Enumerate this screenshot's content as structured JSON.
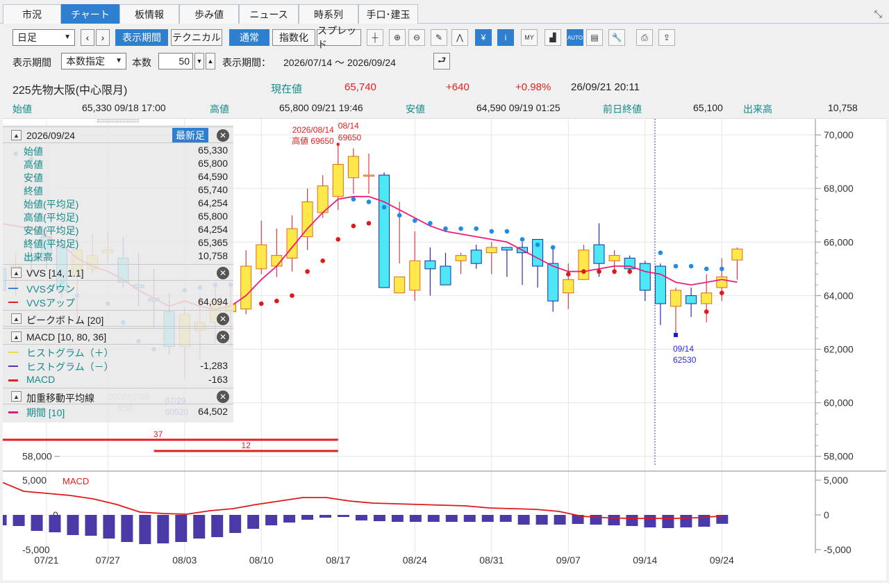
{
  "tabs": [
    "市況",
    "チャート",
    "板情報",
    "歩み値",
    "ニュース",
    "時系列",
    "手口･建玉"
  ],
  "active_tab": "チャート",
  "toolbar": {
    "interval_select": "日足",
    "prev_icon": "‹",
    "next_icon": "›",
    "period_button": "表示期間",
    "technical_button": "テクニカル",
    "normal_button": "通常",
    "index_button": "指数化",
    "spread_button": "スプレッド",
    "icons": [
      "crosshair-icon",
      "zoom-in-icon",
      "zoom-out-icon",
      "pencil-icon",
      "trend-icon",
      "yen-icon",
      "info-icon",
      "my-chart-icon",
      "volume-icon",
      "auto-scale-icon",
      "chart-settings-icon",
      "wrench-icon",
      "print-icon",
      "export-icon"
    ]
  },
  "period_row": {
    "label": "表示期間",
    "mode_select": "本数指定",
    "count_label": "本数",
    "count_value": "50",
    "range_label": "表示期間：",
    "range_value": "2026/07/14 ～ 2026/09/24"
  },
  "quote": {
    "name": "225先物大阪(中心限月)",
    "current_label": "現在値",
    "current_value": "65,740",
    "change": "+640",
    "change_pct": "+0.98%",
    "timestamp": "26/09/21  20:11",
    "open_label": "始値",
    "open_value": "65,330  09/18  17:00",
    "high_label": "高値",
    "high_value": "65,800  09/21  19:46",
    "low_label": "安値",
    "low_value": "64,590  09/19  01:25",
    "prev_close_label": "前日終値",
    "prev_close_value": "65,100",
    "volume_label": "出来高",
    "volume_value": "10,758"
  },
  "panel": {
    "date": "2026/09/24",
    "latest_button": "最新足",
    "ohlc": [
      {
        "k": "始値",
        "v": "65,330"
      },
      {
        "k": "高値",
        "v": "65,800"
      },
      {
        "k": "安値",
        "v": "64,590"
      },
      {
        "k": "終値",
        "v": "65,740"
      },
      {
        "k": "始値(平均足)",
        "v": "64,254"
      },
      {
        "k": "高値(平均足)",
        "v": "65,800"
      },
      {
        "k": "安値(平均足)",
        "v": "64,254"
      },
      {
        "k": "終値(平均足)",
        "v": "65,365"
      },
      {
        "k": "出来高",
        "v": "10,758"
      }
    ],
    "vvs_title": "VVS [14, 1.1]",
    "vvs_down": "VVSダウン",
    "vvs_up": "VVSアップ",
    "vvs_up_value": "64,094",
    "peak_title": "ピークボトム [20]",
    "macd_title": "MACD [10, 80, 36]",
    "hist_plus": "ヒストグラム（＋）",
    "hist_minus": "ヒストグラム（－）",
    "hist_minus_value": "-1,283",
    "macd_label": "MACD",
    "macd_value": "-163",
    "wma_title": "加重移動平均線",
    "wma_period": "期間 [10]",
    "wma_value": "64,502"
  },
  "chart_data": [
    {
      "type": "candlestick",
      "y_ticks": [
        "70,000",
        "68,000",
        "66,000",
        "64,000",
        "62,000",
        "60,000",
        "58,000"
      ],
      "ylim": [
        57500,
        70600
      ],
      "x_ticks": [
        "07/21",
        "07/27",
        "08/03",
        "08/10",
        "08/17",
        "08/24",
        "08/31",
        "09/07",
        "09/14",
        "09/24"
      ],
      "annotations": {
        "high_a": "2026/08/14",
        "high_a2": "高値 69650",
        "high_b": "08/14",
        "high_b2": "69650",
        "low_a": "2026/07/29",
        "low_a2": "安値",
        "low_b": "07/29",
        "low_b2": "60520",
        "low_c": "09/14",
        "low_c2": "62530",
        "bar_37": "37",
        "bar_12": "12",
        "left_axis_label": "58,000"
      },
      "candles": [
        [
          65000,
          65300,
          64000,
          64200
        ],
        [
          64800,
          65600,
          64000,
          65100
        ],
        [
          65500,
          66100,
          64800,
          65300
        ],
        [
          66200,
          66600,
          65000,
          65500
        ],
        [
          65800,
          66100,
          63900,
          64200
        ],
        [
          64800,
          66200,
          63000,
          65700
        ],
        [
          65000,
          66300,
          64800,
          65500
        ],
        [
          65600,
          66400,
          65200,
          65700
        ],
        [
          65400,
          66200,
          64300,
          64500
        ],
        [
          64400,
          65600,
          63600,
          64300
        ],
        [
          63900,
          65000,
          62800,
          63800
        ],
        [
          63400,
          64100,
          61800,
          62100
        ],
        [
          62100,
          63600,
          60900,
          63300
        ],
        [
          62700,
          64000,
          61600,
          63000
        ],
        [
          63000,
          64500,
          62200,
          63800
        ],
        [
          63400,
          64400,
          62100,
          63700
        ],
        [
          63500,
          65700,
          63300,
          65100
        ],
        [
          65000,
          66800,
          64800,
          65900
        ],
        [
          65100,
          66500,
          64700,
          65500
        ],
        [
          65400,
          67000,
          64900,
          66500
        ],
        [
          66200,
          68000,
          65700,
          67500
        ],
        [
          67100,
          68500,
          66900,
          68100
        ],
        [
          67700,
          69650,
          67200,
          68900
        ],
        [
          68400,
          69500,
          67800,
          69200
        ],
        [
          68500,
          69300,
          67800,
          68500
        ],
        [
          68500,
          68600,
          64800,
          64300
        ],
        [
          64100,
          67500,
          65200,
          64700
        ],
        [
          64200,
          66400,
          63800,
          65300
        ],
        [
          65300,
          65800,
          64000,
          65000
        ],
        [
          65100,
          65600,
          64500,
          64400
        ],
        [
          65300,
          65600,
          64800,
          65500
        ],
        [
          65700,
          65900,
          65000,
          65200
        ],
        [
          65600,
          66000,
          64800,
          65800
        ],
        [
          65800,
          65800,
          64700,
          65700
        ],
        [
          65800,
          66000,
          64400,
          65600
        ],
        [
          66100,
          66100,
          64300,
          65100
        ],
        [
          65200,
          65800,
          63400,
          63800
        ],
        [
          64100,
          65200,
          63500,
          64600
        ],
        [
          64600,
          65900,
          64900,
          65700
        ],
        [
          65900,
          66700,
          64700,
          65200
        ],
        [
          65300,
          65700,
          64800,
          65500
        ],
        [
          65400,
          65500,
          64800,
          65000
        ],
        [
          65200,
          65300,
          63800,
          64200
        ],
        [
          65100,
          65200,
          62900,
          63700
        ],
        [
          63600,
          64300,
          62530,
          64200
        ],
        [
          64000,
          64300,
          63200,
          63700
        ],
        [
          63700,
          64800,
          63000,
          64100
        ],
        [
          64300,
          65400,
          63800,
          64700
        ],
        [
          65330,
          65800,
          64590,
          65740
        ]
      ],
      "wma": [
        66700,
        66600,
        66500,
        66200,
        65900,
        65400,
        65100,
        64900,
        64600,
        64200,
        63900,
        63600,
        63800,
        63600,
        63500,
        63600,
        64000,
        64600,
        65100,
        65800,
        66500,
        67100,
        67600,
        67700,
        67700,
        67500,
        67200,
        66900,
        66600,
        66400,
        66300,
        66200,
        66100,
        66000,
        65700,
        65400,
        65100,
        64900,
        64900,
        65000,
        65100,
        65100,
        64900,
        64800,
        64500,
        64400,
        64500,
        64600,
        64502
      ],
      "vvs_down_points": [
        [
          0,
          69550
        ],
        [
          1,
          69300
        ],
        [
          2,
          69100
        ],
        [
          4,
          64500
        ],
        [
          5,
          64000
        ],
        [
          7,
          63700
        ],
        [
          8,
          63000
        ],
        [
          9,
          62300
        ],
        [
          10,
          62000
        ],
        [
          12,
          64200
        ],
        [
          13,
          64300
        ],
        [
          14,
          64400
        ],
        [
          15,
          64400
        ],
        [
          23,
          67600
        ],
        [
          24,
          67500
        ],
        [
          25,
          67300
        ],
        [
          26,
          67000
        ],
        [
          27,
          66800
        ],
        [
          28,
          66700
        ],
        [
          29,
          66500
        ],
        [
          30,
          66500
        ],
        [
          31,
          66500
        ],
        [
          32,
          66400
        ],
        [
          33,
          66400
        ],
        [
          34,
          66100
        ],
        [
          35,
          65900
        ],
        [
          36,
          65800
        ],
        [
          43,
          65600
        ],
        [
          44,
          65100
        ],
        [
          45,
          65100
        ],
        [
          46,
          65000
        ],
        [
          47,
          65000
        ]
      ],
      "vvs_up_points": [
        [
          17,
          63700
        ],
        [
          18,
          63800
        ],
        [
          19,
          64000
        ],
        [
          20,
          64900
        ],
        [
          21,
          65300
        ],
        [
          22,
          66100
        ],
        [
          23,
          66600
        ],
        [
          24,
          66700
        ],
        [
          37,
          64800
        ],
        [
          38,
          64900
        ],
        [
          39,
          64900
        ],
        [
          40,
          64900
        ],
        [
          41,
          64900
        ],
        [
          46,
          63400
        ],
        [
          47,
          64100
        ]
      ]
    },
    {
      "type": "macd",
      "y_ticks": [
        "5,000",
        "0",
        "-5,000"
      ],
      "ylim": [
        -5000,
        5000
      ],
      "series_label": "MACD",
      "histogram": [
        -1500,
        -1600,
        -2300,
        -2500,
        -2900,
        -3000,
        -3400,
        -3900,
        -4200,
        -4100,
        -3900,
        -3400,
        -3200,
        -2600,
        -2000,
        -1500,
        -1100,
        -700,
        -400,
        -300,
        -800,
        -900,
        -1000,
        -1000,
        -1000,
        -1000,
        -1000,
        -1000,
        -1000,
        -1400,
        -1400,
        -1400,
        -1300,
        -1400,
        -1500,
        -1600,
        -1800,
        -1900,
        -1800,
        -1700,
        -1283
      ],
      "macd": [
        4800,
        3400,
        3100,
        2800,
        2300,
        1500,
        400,
        200,
        100,
        600,
        900,
        1500,
        2000,
        2500,
        2500,
        2000,
        1700,
        1600,
        1500,
        1400,
        1300,
        1000,
        900,
        800,
        500,
        -200,
        -400,
        -500,
        -500,
        -500,
        -400,
        -163
      ]
    }
  ]
}
